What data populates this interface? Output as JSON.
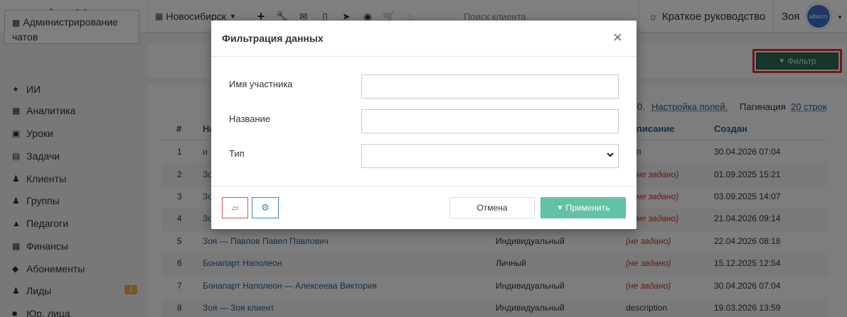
{
  "topbar": {
    "logo_text": "alfacrm",
    "city": "Новосибирск",
    "search_placeholder": "Поиск клиента",
    "guide_label": "Краткое руководство",
    "user_name": "Зоя",
    "avatar_text": "alfacrm",
    "icons": [
      "plus-icon",
      "wrench-icon",
      "envelope-icon",
      "phone-icon",
      "telegram-icon",
      "record-icon",
      "cart-icon",
      "bell-icon"
    ]
  },
  "sidebar": {
    "active_label": "Администрирование чатов",
    "items": [
      {
        "label": "ИИ",
        "icon": "sparkle-icon"
      },
      {
        "label": "Аналитика",
        "icon": "map-icon"
      },
      {
        "label": "Уроки",
        "icon": "calendar-icon"
      },
      {
        "label": "Задачи",
        "icon": "clipboard-icon"
      },
      {
        "label": "Клиенты",
        "icon": "user-icon"
      },
      {
        "label": "Группы",
        "icon": "users-icon"
      },
      {
        "label": "Педагоги",
        "icon": "graduation-cap-icon"
      },
      {
        "label": "Финансы",
        "icon": "money-icon"
      },
      {
        "label": "Абонементы",
        "icon": "tag-icon"
      },
      {
        "label": "Лиды",
        "icon": "user-icon",
        "badge": "1"
      },
      {
        "label": "Юр. лица",
        "icon": "briefcase-icon"
      }
    ]
  },
  "main": {
    "filter_button": "Фильтр",
    "topline_suffix": "0.",
    "settings_link": "Настройка полей.",
    "pagination_label": "Пагинация",
    "pagination_value": "20 строк",
    "columns": {
      "num": "#",
      "name": "На",
      "description": "писание",
      "created": "Создан"
    },
    "rows": [
      {
        "num": "1",
        "name": "и",
        "type": "",
        "description": "п",
        "created": "30.04.2026 07:04"
      },
      {
        "num": "2",
        "name": "Зо",
        "type": "",
        "description": "не задано)",
        "created": "01.09.2025 15:21"
      },
      {
        "num": "3",
        "name": "Зо",
        "type": "",
        "description": "не задано)",
        "created": "03.09.2025 14:07"
      },
      {
        "num": "4",
        "name": "Зо",
        "type": "",
        "description": "не задано)",
        "created": "21.04.2026 09:14"
      },
      {
        "num": "5",
        "name": "Зоя — Павлов Павел Павлович",
        "type": "Индивидуальный",
        "description": "(не задано)",
        "created": "22.04.2026 08:18"
      },
      {
        "num": "6",
        "name": "Бонапарт Наполеон",
        "type": "Личный",
        "description": "(не задано)",
        "created": "15.12.2025 12:54"
      },
      {
        "num": "7",
        "name": "Бонапарт Наполеон — Алексеева Виктория",
        "type": "Индивидуальный",
        "description": "(не задано)",
        "created": "30.04.2026 07:04"
      },
      {
        "num": "8",
        "name": "Зоя — Зоя клиент",
        "type": "Индивидуальный",
        "description": "description",
        "created": "19.03.2026 13:59"
      }
    ]
  },
  "modal": {
    "title": "Фильтрация данных",
    "fields": [
      {
        "label": "Имя участника",
        "value": ""
      },
      {
        "label": "Название",
        "value": ""
      },
      {
        "label": "Тип",
        "value": ""
      }
    ],
    "cancel_label": "Отмена",
    "apply_label": "Применить"
  },
  "colors": {
    "brand": "#3b7dbf",
    "apply": "#62c2a6",
    "filter_button": "#2e6b5a",
    "highlight_border": "#e53131",
    "empty_value": "#c0392b",
    "link": "#2a5d8f"
  }
}
